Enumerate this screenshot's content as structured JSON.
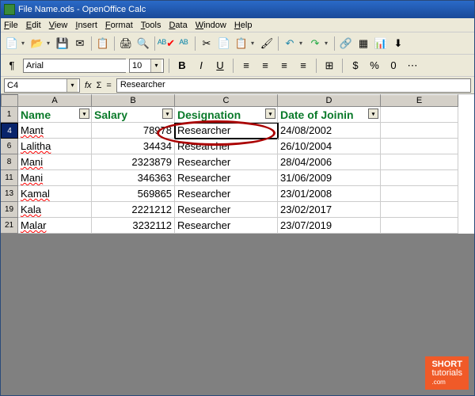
{
  "title": "File Name.ods - OpenOffice Calc",
  "menu": {
    "file": "File",
    "edit": "Edit",
    "view": "View",
    "insert": "Insert",
    "format": "Format",
    "tools": "Tools",
    "data": "Data",
    "window": "Window",
    "help": "Help"
  },
  "font": {
    "name": "Arial",
    "size": "10"
  },
  "ref": {
    "cell": "C4",
    "formula": "Researcher",
    "sigma": "Σ",
    "fx": "fx",
    "eq": "="
  },
  "cols": {
    "a": "A",
    "b": "B",
    "c": "C",
    "d": "D",
    "e": "E"
  },
  "colw": {
    "a": 93,
    "b": 105,
    "c": 130,
    "d": 130,
    "e": 98
  },
  "headers": {
    "a": "Name",
    "b": "Salary",
    "c": "Designation",
    "d": "Date of Joinin"
  },
  "rows": [
    {
      "n": "4",
      "a": "Mant",
      "b": "78978",
      "c": "Researcher",
      "d": "24/08/2002",
      "sel": true
    },
    {
      "n": "6",
      "a": "Lalitha",
      "b": "34434",
      "c": "Researcher",
      "d": "26/10/2004"
    },
    {
      "n": "8",
      "a": "Mani",
      "b": "2323879",
      "c": "Researcher",
      "d": "28/04/2006"
    },
    {
      "n": "11",
      "a": "Mani",
      "b": "346363",
      "c": "Researcher",
      "d": "31/06/2009"
    },
    {
      "n": "13",
      "a": "Kamal",
      "b": "569865",
      "c": "Researcher",
      "d": "23/01/2008"
    },
    {
      "n": "19",
      "a": "Kala",
      "b": "2221212",
      "c": "Researcher",
      "d": "23/02/2017"
    },
    {
      "n": "21",
      "a": "Malar",
      "b": "3232112",
      "c": "Researcher",
      "d": "23/07/2019"
    }
  ],
  "logo": {
    "l1": "SHORT",
    "l2": "tutorials",
    "l3": ".com"
  },
  "icons": {
    "new": "📄",
    "open": "📂",
    "save": "💾",
    "mail": "✉",
    "paste": "📋",
    "print": "🖨",
    "preview": "🔍",
    "spell": "✔",
    "autospell": "✎",
    "cut": "✂",
    "copy": "📄",
    "pasteic": "📋",
    "brush": "🖌",
    "undo": "↶",
    "redo": "↷",
    "link": "🔗",
    "grid": "▦",
    "chart": "📊",
    "sort": "⬇",
    "help": "?",
    "styles": "¶",
    "bold": "B",
    "italic": "I",
    "under": "U",
    "al": "≡",
    "ac": "≡",
    "ar": "≡",
    "aj": "≡",
    "merge": "⊞",
    "cur": "$",
    "pct": "%",
    "dec": "0",
    "dots": "⋯"
  }
}
